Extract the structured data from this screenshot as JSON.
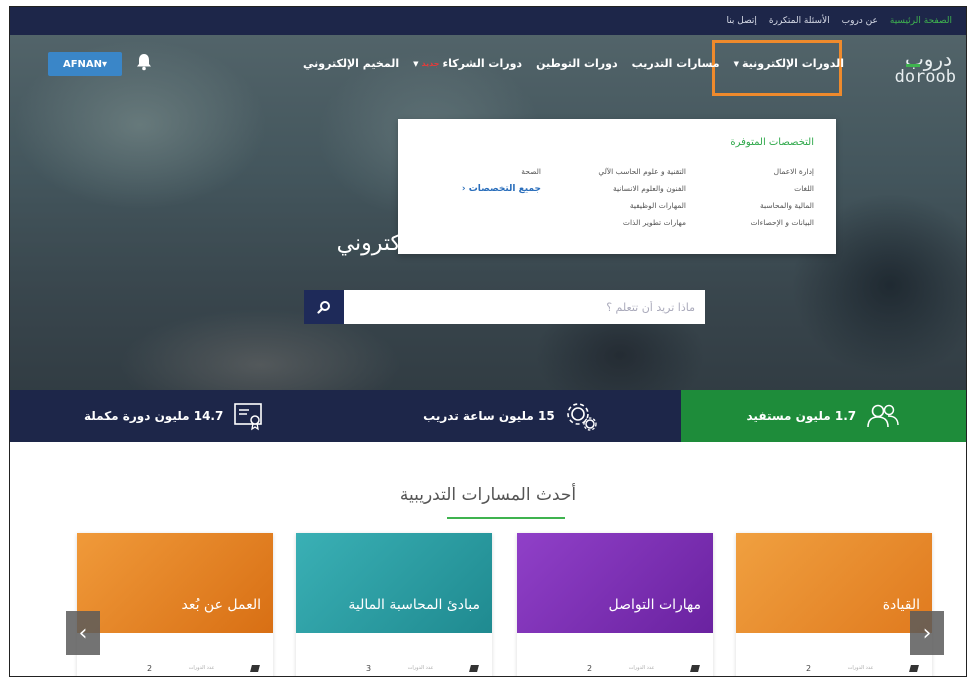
{
  "topbar": {
    "links": [
      "الصفحة الرئيسية",
      "عن دروب",
      "الأسئلة المتكررة",
      "إتصل بنا"
    ]
  },
  "logo": {
    "arabic": "دروب",
    "latin": "doroob"
  },
  "nav": {
    "items": [
      {
        "label": "الدورات الإلكترونية",
        "has_caret": true
      },
      {
        "label": "مسارات التدريب"
      },
      {
        "label": "دورات التوطين"
      },
      {
        "label": "دورات الشركاء",
        "badge": "جديد",
        "has_caret": true
      },
      {
        "label": "المخيم الإلكتروني"
      }
    ],
    "user_label": "AFNAN",
    "user_caret": "▾",
    "bell_icon": "bell-icon"
  },
  "dropdown": {
    "title": "التخصصات المتوفرة",
    "col1": [
      "إدارة الاعمال",
      "اللغات",
      "المالية والمحاسبة",
      "البيانات و الإحصاءات"
    ],
    "col2": [
      "التقنية و علوم الحاسب الآلي",
      "الفنون والعلوم الانسانية",
      "المهارات الوظيفية",
      "مهارات تطوير الذات"
    ],
    "col3": [
      "الصحة"
    ],
    "all_link": "جميع التخصصات ‹"
  },
  "hero": {
    "title_fragment": "كتروني",
    "search_placeholder": "ماذا تريد أن تتعلم ؟"
  },
  "stats": [
    {
      "text": "1.7 مليون مستفيد",
      "icon": "users-icon"
    },
    {
      "text": "15 مليون ساعة تدريب",
      "icon": "gears-icon"
    },
    {
      "text": "14.7 مليون دورة مكملة",
      "icon": "certificate-icon"
    }
  ],
  "section": {
    "title": "أحدث المسارات التدريبية"
  },
  "cards": [
    {
      "title": "القيادة",
      "color": "#e8892a",
      "count": "2",
      "meta_label": "عدد الدورات"
    },
    {
      "title": "مهارات التواصل",
      "color": "#7a2bb0",
      "count": "2",
      "meta_label": "عدد الدورات"
    },
    {
      "title": "مبادئ المحاسبة المالية",
      "color": "#2a9aa0",
      "count": "3",
      "meta_label": "عدد الدورات"
    },
    {
      "title": "العمل عن بُعد",
      "color": "#e07a20",
      "count": "2",
      "meta_label": "عدد الدورات"
    }
  ],
  "carousel": {
    "prev": "‹",
    "next": "›"
  },
  "colors": {
    "navy": "#1d2649",
    "green": "#1e8c3a",
    "accent_orange": "#ef8a2c",
    "user_blue": "#3a86c8"
  }
}
